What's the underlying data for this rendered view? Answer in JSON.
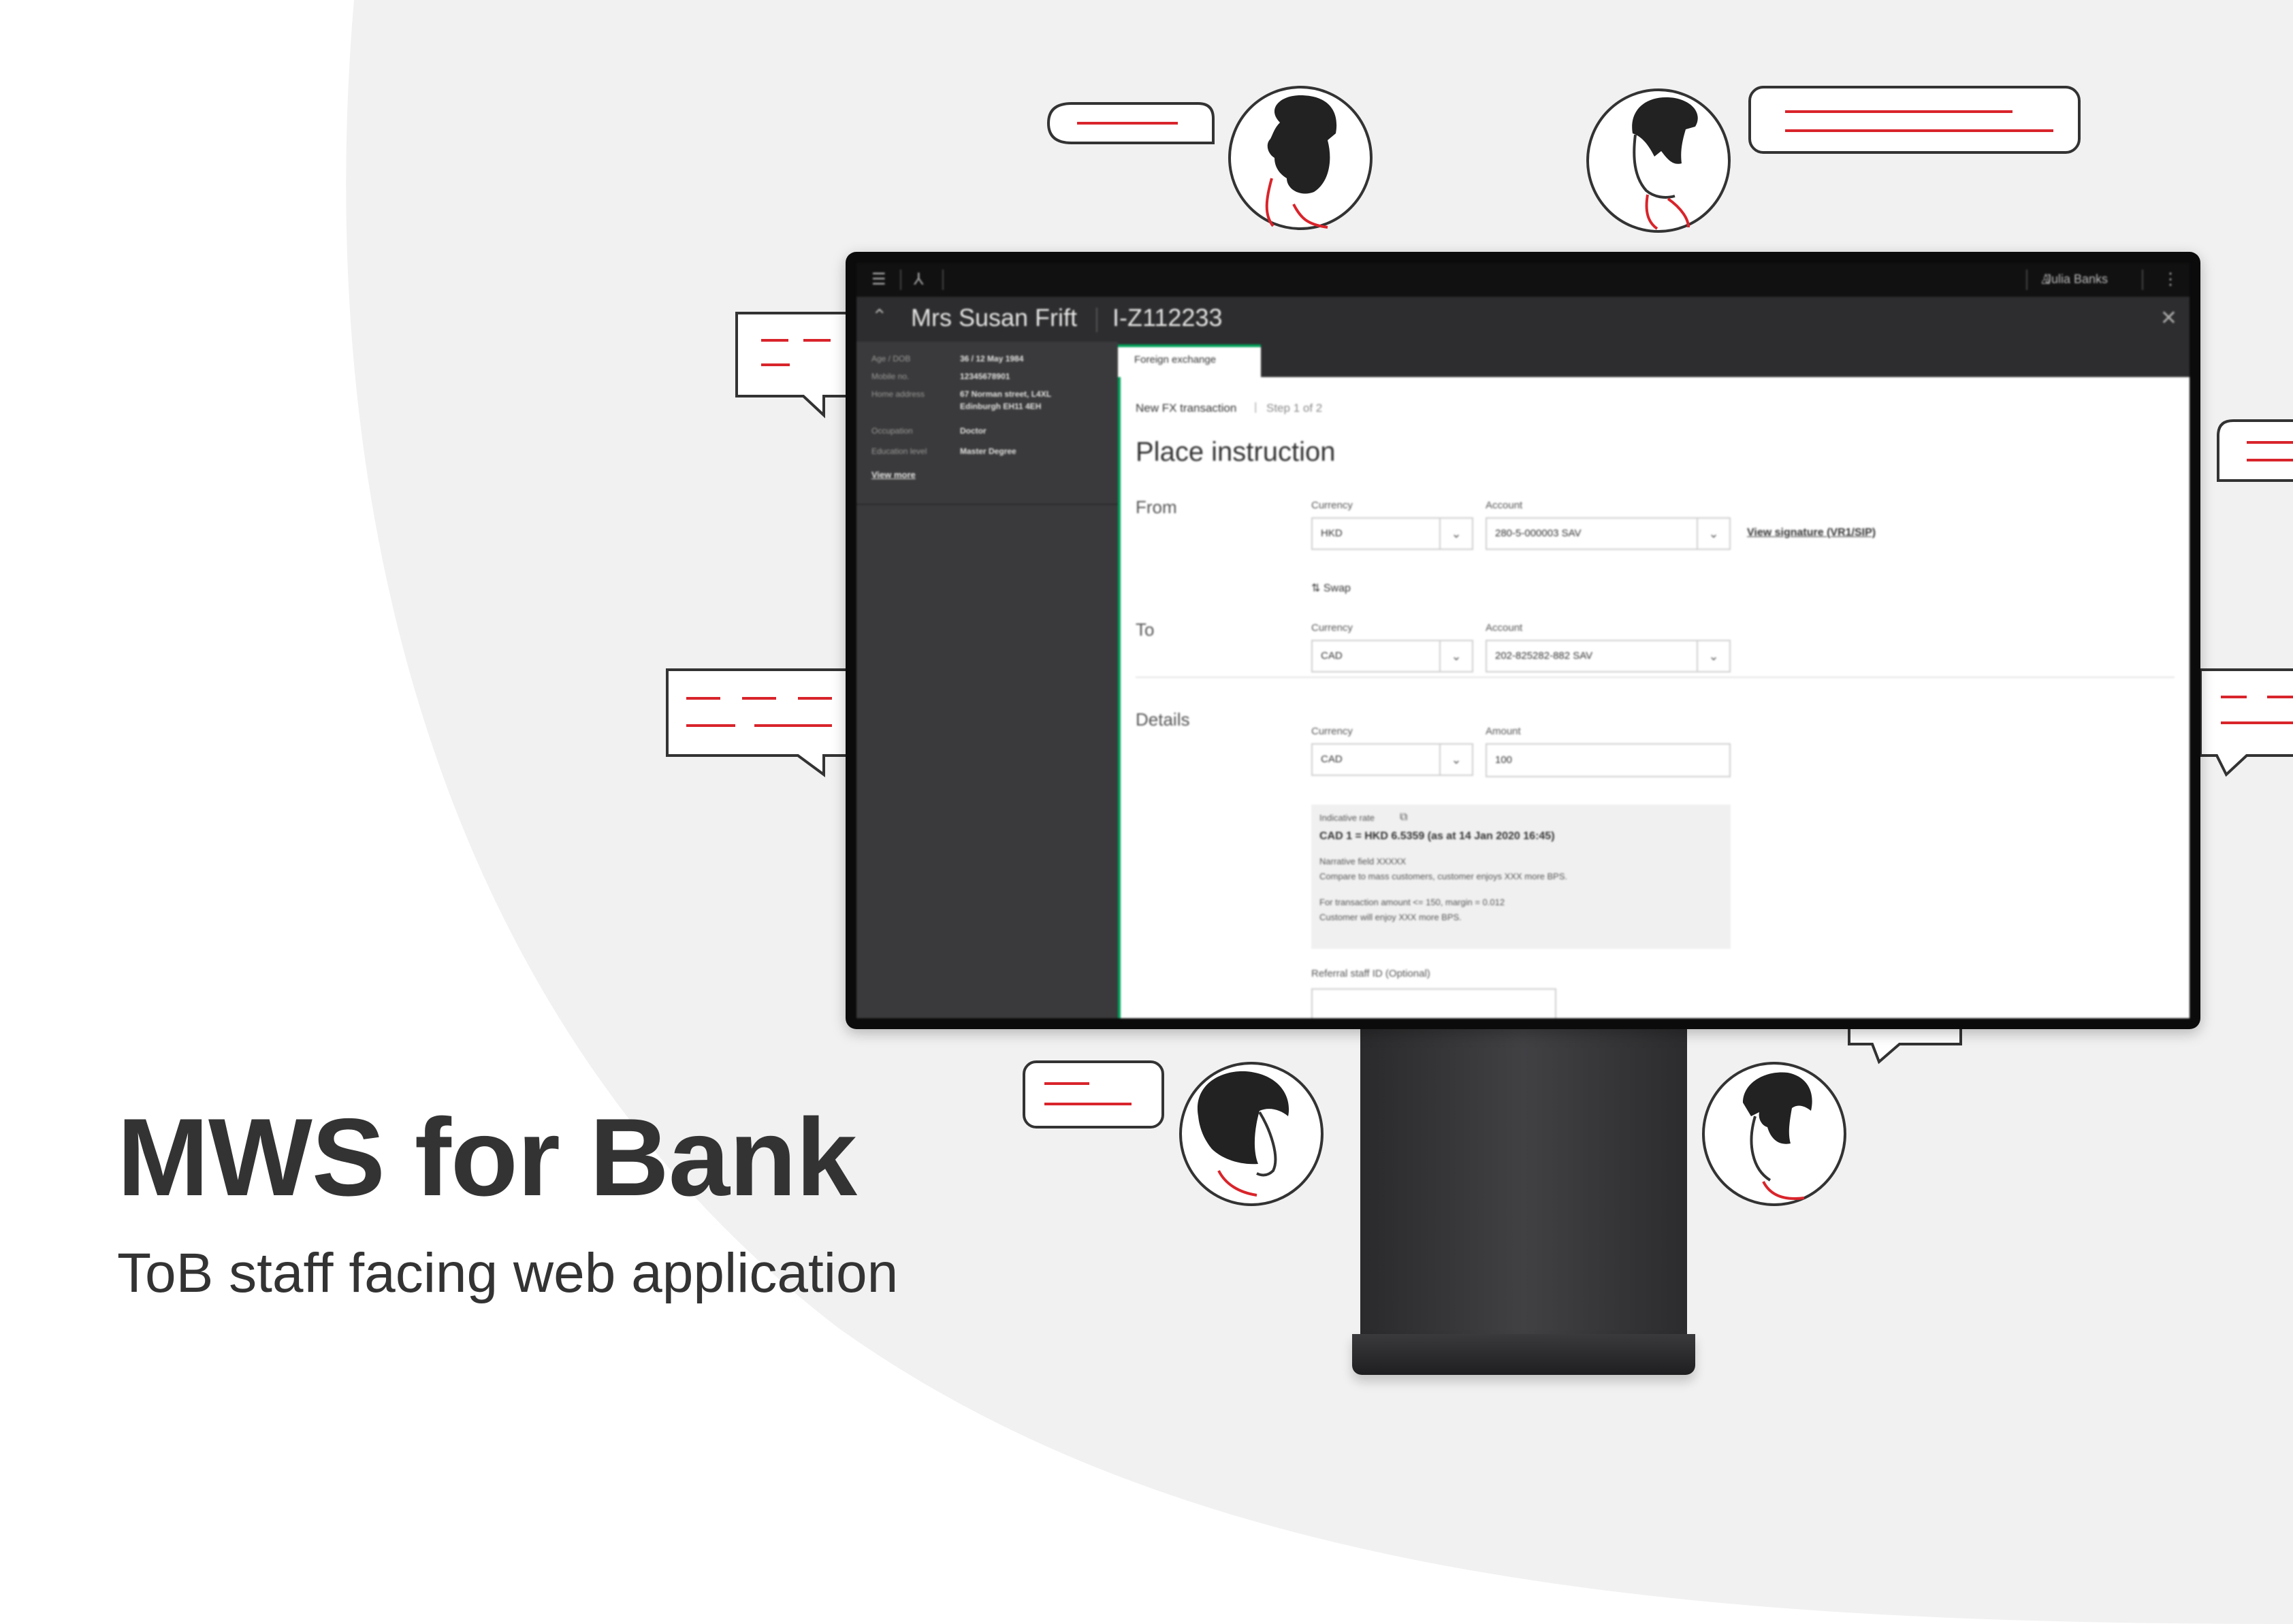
{
  "hero": {
    "title": "MWS for Bank",
    "subtitle": "ToB staff facing web application"
  },
  "colors": {
    "accent_red": "#d9242b",
    "success_green": "#00a35a",
    "background_swoosh": "#f1f1f1",
    "text_dark": "#333333"
  },
  "decoration_icons": [
    "bearded-man-avatar-icon",
    "man-with-quiff-avatar-icon",
    "woman-bob-hair-avatar-icon",
    "man-short-hair-avatar-icon",
    "speech-bubble-icon"
  ],
  "app": {
    "topbar": {
      "menu_icon": "hamburger-icon",
      "tree_icon": "hierarchy-icon",
      "user_icon": "person-icon",
      "user_name": "Julia Banks",
      "more_icon": "kebab-menu-icon"
    },
    "customer": {
      "name": "Mrs Susan Frift",
      "id": "I-Z112233",
      "collapse_icon": "chevron-up-icon",
      "close_icon": "close-icon"
    },
    "profile": {
      "rows": [
        {
          "label": "Age / DOB",
          "value": "36 / 12 May 1984"
        },
        {
          "label": "Mobile no.",
          "value": "12345678901"
        },
        {
          "label": "Home address",
          "value": "67 Norman street, L4XL"
        },
        {
          "label": "",
          "value": "Edinburgh EH11 4EH"
        },
        {
          "label": "Occupation",
          "value": "Doctor"
        },
        {
          "label": "Education level",
          "value": "Master Degree"
        }
      ],
      "view_more": "View more"
    },
    "tabs": [
      {
        "label": "Foreign exchange",
        "active": true
      }
    ],
    "breadcrumb": {
      "current": "New FX transaction",
      "separator": "|",
      "step": "Step 1 of 2"
    },
    "page_title": "Place instruction",
    "from": {
      "section": "From",
      "currency_label": "Currency",
      "currency_value": "HKD",
      "account_label": "Account",
      "account_value": "280-5-000003 SAV",
      "signature_link": "View signature (VR1/SIP)"
    },
    "swap": {
      "icon": "swap-arrows-icon",
      "label": "Swap"
    },
    "to": {
      "section": "To",
      "currency_label": "Currency",
      "currency_value": "CAD",
      "account_label": "Account",
      "account_value": "202-825282-882 SAV"
    },
    "details": {
      "section": "Details",
      "currency_label": "Currency",
      "currency_value": "CAD",
      "amount_label": "Amount",
      "amount_value": "100"
    },
    "rate": {
      "label": "Indicative rate",
      "copy_icon": "copy-icon",
      "value": "CAD 1 = HKD 6.5359 (as at 14 Jan 2020 16:45)",
      "line1": "Narrative field XXXXX",
      "line2": "Compare to mass customers, customer enjoys XXX more BPS.",
      "line3": "For transaction amount <= 150, margin = 0.012",
      "line4": "Customer will enjoy XXX more BPS."
    },
    "referral": {
      "label": "Referral staff ID (Optional)",
      "value": ""
    }
  }
}
